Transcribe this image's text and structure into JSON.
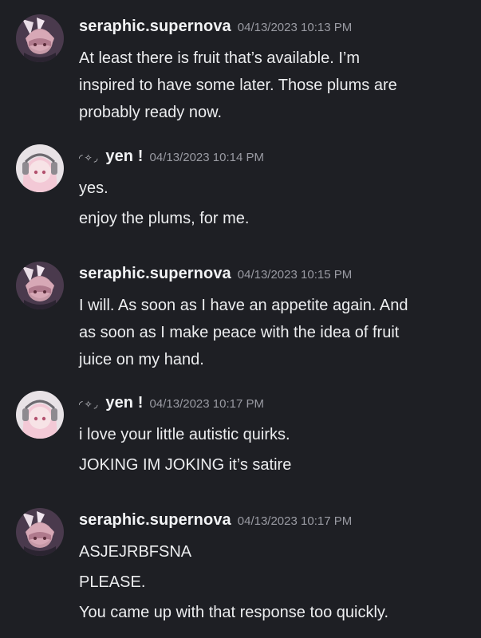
{
  "messages": [
    {
      "user": "seraphic.supernova",
      "user_prefix": "",
      "timestamp": "04/13/2023 10:13 PM",
      "avatar": "seraphic-avatar",
      "paragraphs": [
        [
          "At least there is fruit that’s available. I’m",
          "inspired to have some later. Those plums are",
          "probably ready now."
        ]
      ]
    },
    {
      "user": "yen !",
      "user_prefix": "◜✧◞",
      "timestamp": "04/13/2023 10:14 PM",
      "avatar": "yen-avatar",
      "paragraphs": [
        [
          "yes."
        ],
        [
          "enjoy the plums, for me."
        ]
      ]
    },
    {
      "user": "seraphic.supernova",
      "user_prefix": "",
      "timestamp": "04/13/2023 10:15 PM",
      "avatar": "seraphic-avatar",
      "paragraphs": [
        [
          "I will. As soon as I have an appetite again. And",
          "as soon as I make peace with the idea of fruit",
          "juice on my hand."
        ]
      ]
    },
    {
      "user": "yen !",
      "user_prefix": "◜✧◞",
      "timestamp": "04/13/2023 10:17 PM",
      "avatar": "yen-avatar",
      "paragraphs": [
        [
          "i love your little autistic quirks."
        ],
        [
          "JOKING IM JOKING it’s satire"
        ]
      ]
    },
    {
      "user": "seraphic.supernova",
      "user_prefix": "",
      "timestamp": "04/13/2023 10:17 PM",
      "avatar": "seraphic-avatar",
      "paragraphs": [
        [
          "ASJEJRBFSNA"
        ],
        [
          "PLEASE."
        ],
        [
          "You came up with that response too quickly."
        ]
      ]
    }
  ]
}
